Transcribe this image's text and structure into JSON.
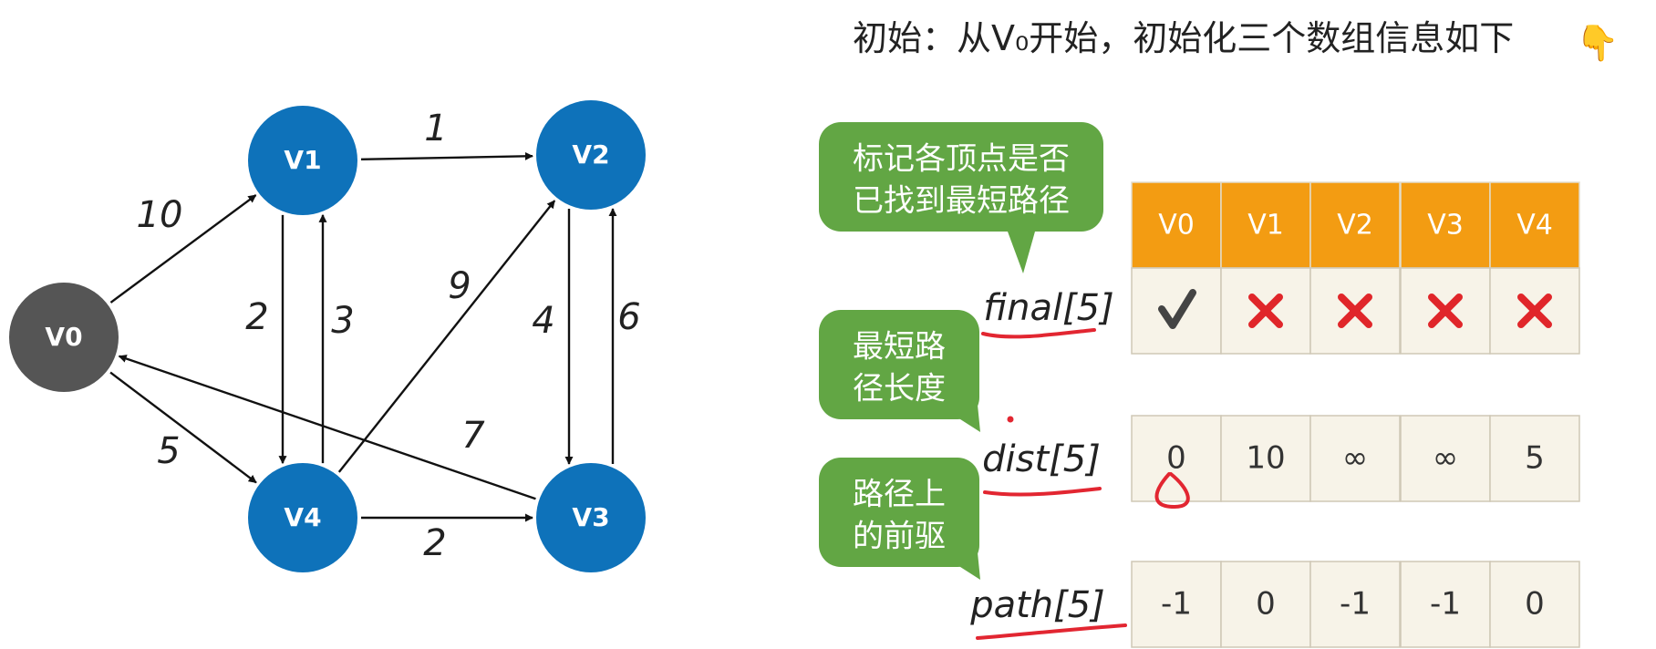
{
  "header": {
    "title": "初始：从V₀开始，初始化三个数组信息如下",
    "emoji": "👇"
  },
  "graph": {
    "nodes": [
      {
        "id": "V0",
        "label": "V0",
        "kind": "start"
      },
      {
        "id": "V1",
        "label": "V1",
        "kind": "normal"
      },
      {
        "id": "V2",
        "label": "V2",
        "kind": "normal"
      },
      {
        "id": "V3",
        "label": "V3",
        "kind": "normal"
      },
      {
        "id": "V4",
        "label": "V4",
        "kind": "normal"
      }
    ],
    "edges": [
      {
        "from": "V0",
        "to": "V1",
        "weight": "10"
      },
      {
        "from": "V0",
        "to": "V4",
        "weight": "5"
      },
      {
        "from": "V1",
        "to": "V2",
        "weight": "1"
      },
      {
        "from": "V1",
        "to": "V4",
        "weight": "2"
      },
      {
        "from": "V4",
        "to": "V1",
        "weight": "3"
      },
      {
        "from": "V4",
        "to": "V2",
        "weight": "9"
      },
      {
        "from": "V2",
        "to": "V3",
        "weight": "4"
      },
      {
        "from": "V3",
        "to": "V2",
        "weight": "6"
      },
      {
        "from": "V3",
        "to": "V0",
        "weight": "7"
      },
      {
        "from": "V4",
        "to": "V3",
        "weight": "2"
      }
    ]
  },
  "callouts": {
    "final": "标记各顶点是否\n已找到最短路径",
    "dist": "最短路\n径长度",
    "path": "路径上\n的前驱"
  },
  "table": {
    "headers": [
      "V0",
      "V1",
      "V2",
      "V3",
      "V4"
    ],
    "rows": [
      {
        "label": "final[5]",
        "cells": [
          "check",
          "cross",
          "cross",
          "cross",
          "cross"
        ]
      },
      {
        "label": "dist[5]",
        "cells": [
          "0",
          "10",
          "∞",
          "∞",
          "5"
        ]
      },
      {
        "label": "path[5]",
        "cells": [
          "-1",
          "0",
          "-1",
          "-1",
          "0"
        ]
      }
    ]
  },
  "colors": {
    "node_blue": "#0e72ba",
    "node_gray": "#555555",
    "header_orange": "#f39c12",
    "cell_bg": "#f7f3e8",
    "callout_green": "#62a644",
    "cross_red": "#e0262a",
    "annotation_red": "#e22631"
  }
}
